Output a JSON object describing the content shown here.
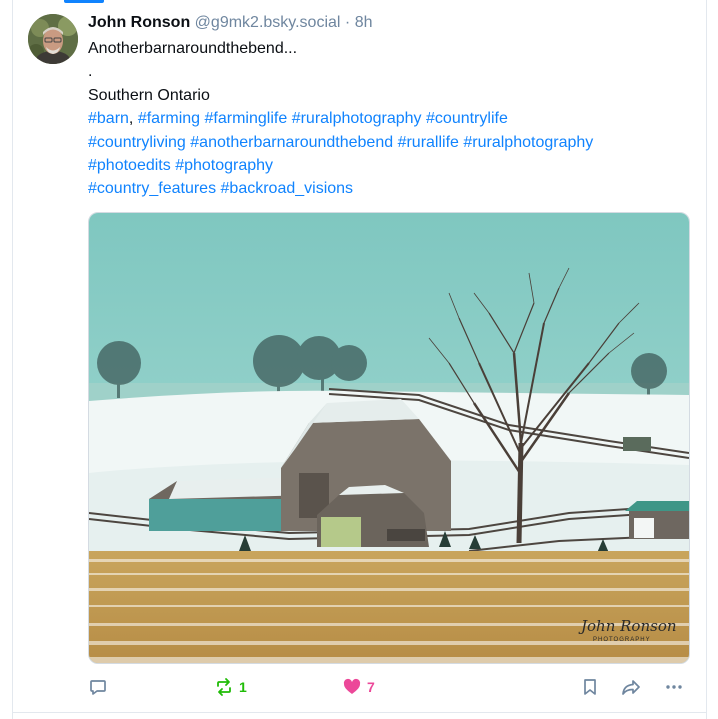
{
  "post": {
    "author_name": "John Ronson",
    "handle": "@g9mk2.bsky.social",
    "separator": "·",
    "time": "8h",
    "text_line1": "Anotherbarnaroundthebend...",
    "text_line2": ".",
    "text_line3": "Southern Ontario",
    "hashtags": {
      "barn": "#barn",
      "comma": ",",
      "farming": "#farming",
      "farminglife": "#farminglife",
      "ruralphotography": "#ruralphotography",
      "countrylife": "#countrylife",
      "countryliving": "#countryliving",
      "anotherbarnaroundthebend": "#anotherbarnaroundthebend",
      "rurallife": "#rurallife",
      "ruralphotography2": "#ruralphotography",
      "photoedits": "#photoedits",
      "photography": "#photography",
      "country_features": "#country_features",
      "backroad_visions": "#backroad_visions"
    },
    "image": {
      "watermark_signature": "John Ronson",
      "watermark_sub": "PHOTOGRAPHY"
    }
  },
  "actions": {
    "reply_icon": "speech-bubble-icon",
    "repost_icon": "repost-arrows-icon",
    "repost_count": "1",
    "like_icon": "heart-icon",
    "like_count": "7",
    "bookmark_icon": "bookmark-icon",
    "share_icon": "share-arrow-icon",
    "more_icon": "ellipsis-icon"
  },
  "colors": {
    "link": "#1083fe",
    "repost_active": "#20bc07",
    "like_active": "#ec4899",
    "muted": "#6f869f"
  }
}
